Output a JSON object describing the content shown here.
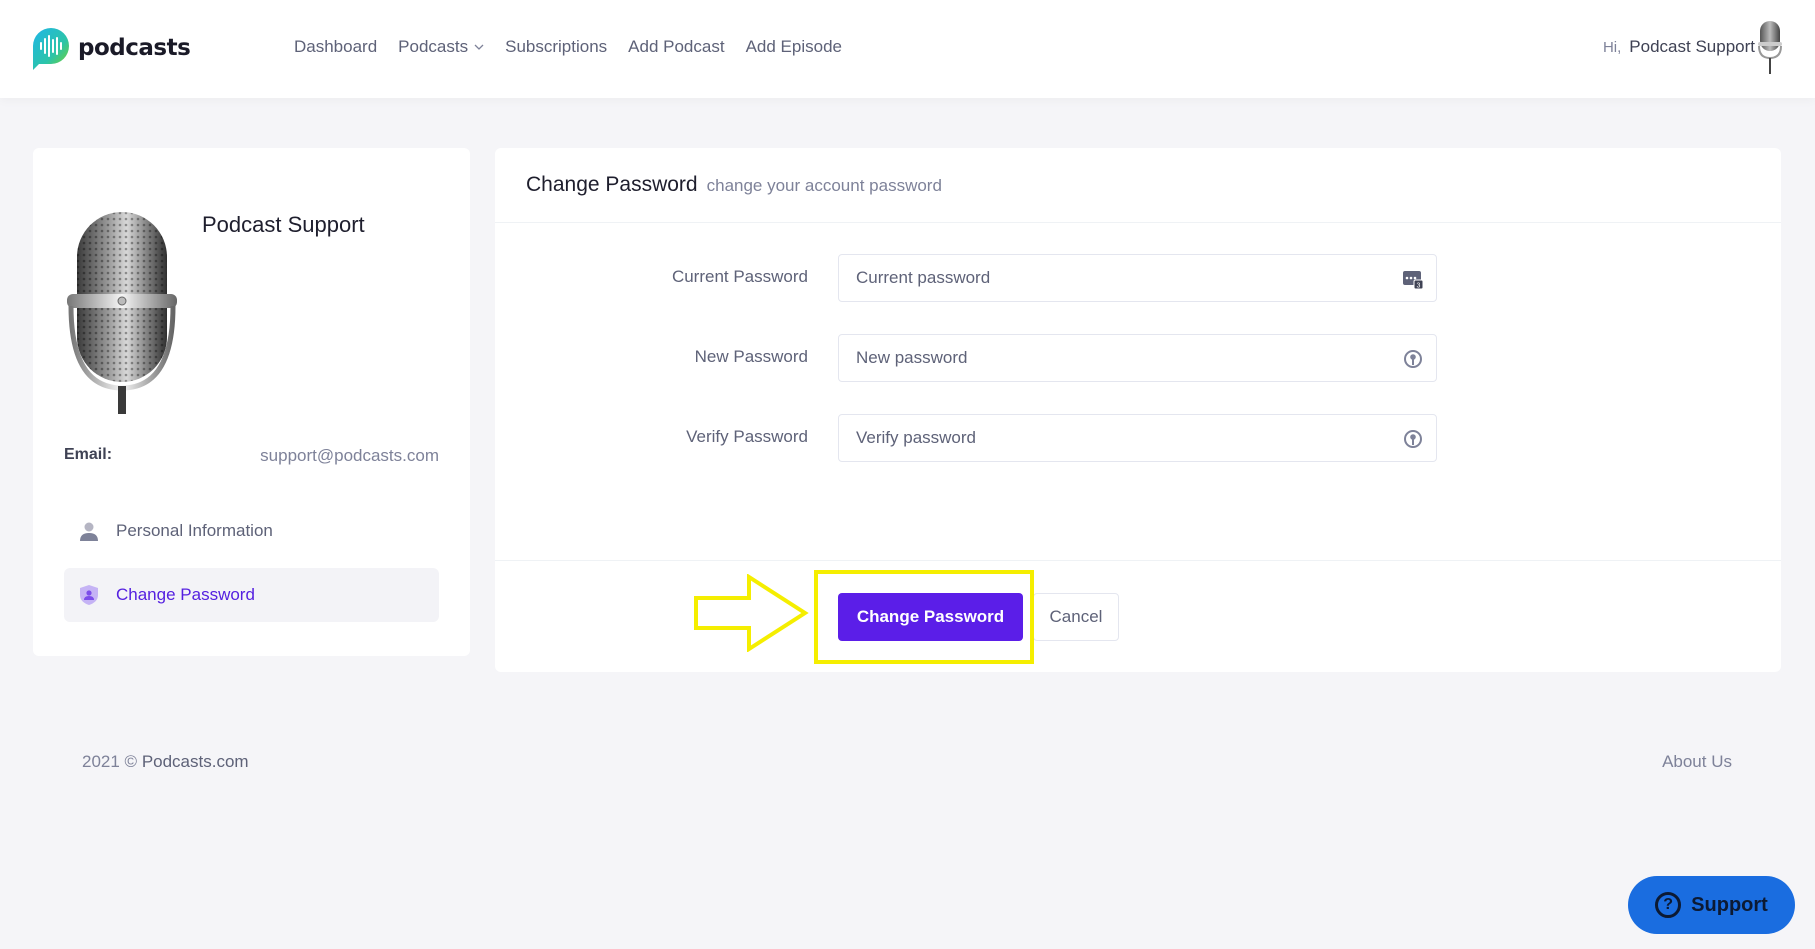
{
  "header": {
    "logo_text": "podcasts",
    "nav": [
      {
        "label": "Dashboard",
        "dropdown": false
      },
      {
        "label": "Podcasts",
        "dropdown": true
      },
      {
        "label": "Subscriptions",
        "dropdown": false
      },
      {
        "label": "Add Podcast",
        "dropdown": false
      },
      {
        "label": "Add Episode",
        "dropdown": false
      }
    ],
    "greeting": "Hi,",
    "user_name": "Podcast Support"
  },
  "profile": {
    "name": "Podcast Support",
    "email_label": "Email:",
    "email_value": "support@podcasts.com",
    "menu": [
      {
        "label": "Personal Information",
        "icon": "user-icon",
        "active": false
      },
      {
        "label": "Change Password",
        "icon": "shield-user-icon",
        "active": true
      }
    ]
  },
  "form": {
    "title": "Change Password",
    "subtitle": "change your account password",
    "fields": [
      {
        "label": "Current Password",
        "placeholder": "Current password",
        "icon": "password-manager-icon"
      },
      {
        "label": "New Password",
        "placeholder": "New password",
        "icon": "key-lock-icon"
      },
      {
        "label": "Verify Password",
        "placeholder": "Verify password",
        "icon": "key-lock-icon"
      }
    ],
    "submit_label": "Change Password",
    "cancel_label": "Cancel"
  },
  "footer": {
    "year": "2021 ©",
    "brand": "Podcasts.com",
    "about": "About Us"
  },
  "support": {
    "label": "Support",
    "icon": "question-icon"
  },
  "colors": {
    "accent": "#5b1ee8",
    "highlight": "#f5ee00",
    "support_bg": "#1a6de0"
  }
}
